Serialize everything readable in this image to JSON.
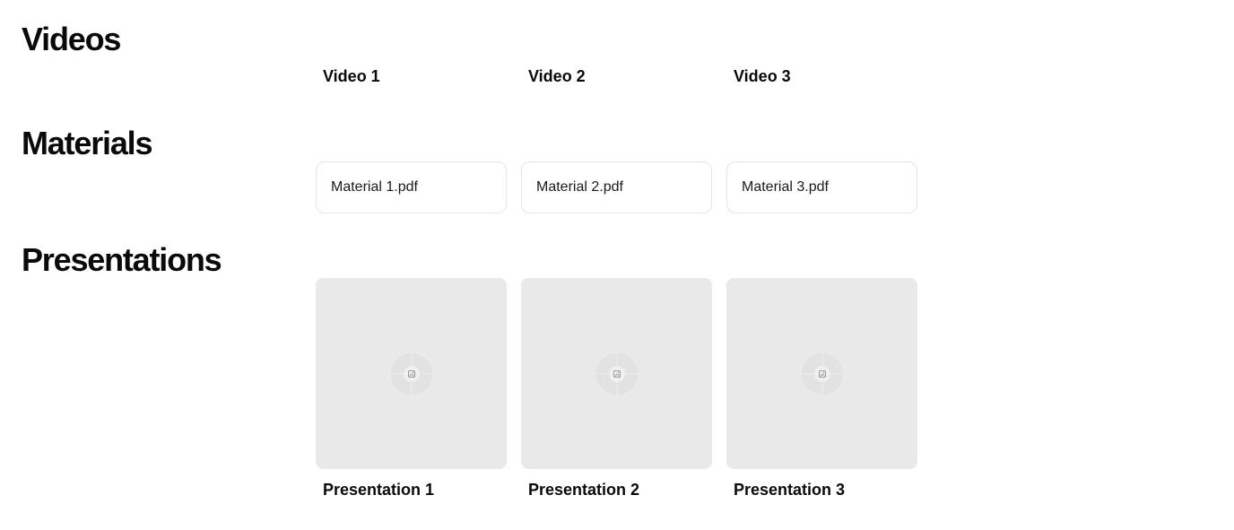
{
  "sections": {
    "videos": {
      "title": "Videos",
      "items": [
        {
          "label": "Video 1"
        },
        {
          "label": "Video 2"
        },
        {
          "label": "Video 3"
        }
      ]
    },
    "materials": {
      "title": "Materials",
      "items": [
        {
          "label": "Material 1.pdf"
        },
        {
          "label": "Material 2.pdf"
        },
        {
          "label": "Material 3.pdf"
        }
      ]
    },
    "presentations": {
      "title": "Presentations",
      "items": [
        {
          "label": "Presentation 1",
          "thumbnail_icon": "image-placeholder-icon"
        },
        {
          "label": "Presentation 2",
          "thumbnail_icon": "image-placeholder-icon"
        },
        {
          "label": "Presentation 3",
          "thumbnail_icon": "image-placeholder-icon"
        }
      ]
    }
  },
  "colors": {
    "text": "#0a0a0a",
    "card_border": "#e4e4e4",
    "thumbnail_bg": "#e9e9e9"
  }
}
